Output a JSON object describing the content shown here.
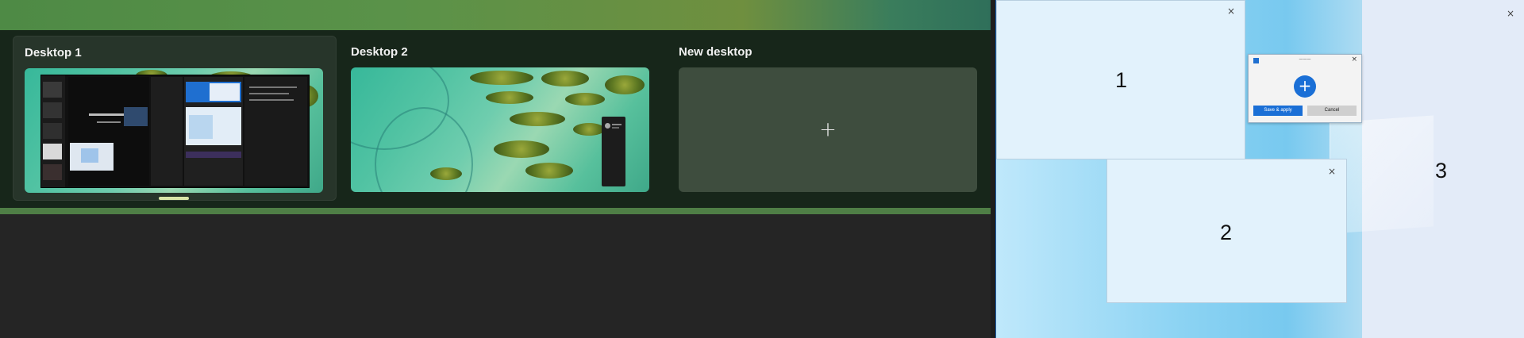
{
  "task_view": {
    "desktops": [
      {
        "title": "Desktop 1",
        "selected": true
      },
      {
        "title": "Desktop 2",
        "selected": false
      }
    ],
    "new_desktop": {
      "title": "New desktop",
      "plus": "+"
    }
  },
  "desktop_preview": {
    "windows": [
      {
        "number": "1",
        "close": "×"
      },
      {
        "number": "2",
        "close": "×"
      },
      {
        "number": "3",
        "close": "×"
      }
    ],
    "dialog": {
      "title": "———",
      "close": "×",
      "add": "+",
      "save_label": "Save & apply",
      "cancel_label": "Cancel"
    }
  },
  "colors": {
    "accent": "#1a6fd6",
    "active_indicator": "#d9e6a8"
  }
}
